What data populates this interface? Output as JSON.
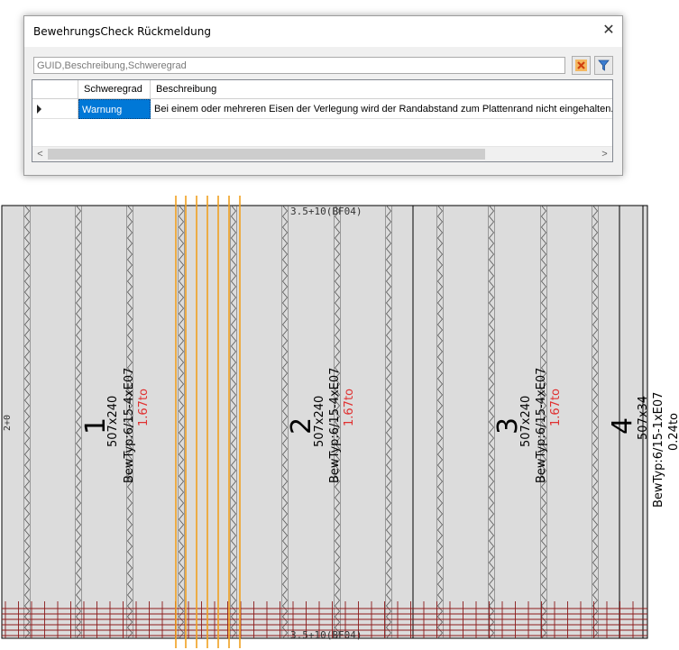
{
  "dialog": {
    "title": "BewehrungsCheck Rückmeldung",
    "close_glyph": "✕",
    "filter_placeholder": "GUID,Beschreibung,Schweregrad",
    "filter_value": ""
  },
  "grid": {
    "columns": [
      "Schweregrad",
      "Beschreibung"
    ],
    "rows": [
      {
        "severity": "Warnung",
        "description": "Bei einem oder mehreren Eisen der Verlegung wird der Randabstand zum Plattenrand nicht eingehalten."
      }
    ],
    "scroll_left_glyph": "<",
    "scroll_right_glyph": ">"
  },
  "drawing": {
    "top_label": "3.5+10(BF04)",
    "bottom_label": "3.5+10(BF04)",
    "left_edge_label": "2+0",
    "panels": [
      {
        "number": "1",
        "size": "507x240",
        "bew_typ": "BewTyp:6/15-4xE07",
        "weight": "1.67to"
      },
      {
        "number": "2",
        "size": "507x240",
        "bew_typ": "BewTyp:6/15-4xE07",
        "weight": "1.67to"
      },
      {
        "number": "3",
        "size": "507x240",
        "bew_typ": "BewTyp:6/15-4xE07",
        "weight": "1.67to"
      },
      {
        "number": "4",
        "size": "507x34",
        "bew_typ": "BewTyp:6/15-1xE07",
        "weight": "0.24to"
      }
    ],
    "colors": {
      "panel_fill": "#dcdcdc",
      "outline": "#000000",
      "selection_orange": "#f0a020",
      "rebar_red": "#8b1a1a",
      "weight_red": "#e03030",
      "zigzag": "#555555"
    }
  }
}
